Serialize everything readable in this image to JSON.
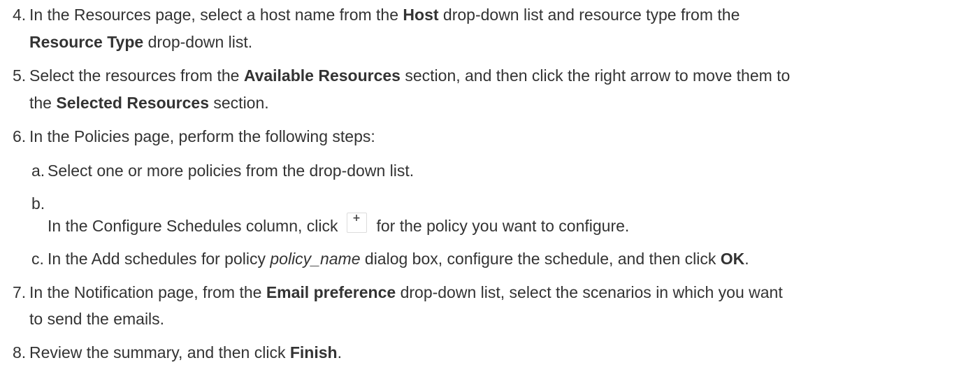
{
  "steps": [
    {
      "num": "4.",
      "line1": {
        "t1": "In the Resources page, select a host name from the ",
        "b1": "Host",
        "t2": " drop-down list and resource type from the"
      },
      "line2": {
        "b1": "Resource Type",
        "t1": " drop-down list."
      }
    },
    {
      "num": "5.",
      "line1": {
        "t1": "Select the resources from the ",
        "b1": "Available Resources",
        "t2": " section, and then click the right arrow to move them to"
      },
      "line2": {
        "t1": "the ",
        "b1": "Selected Resources",
        "t2": " section."
      }
    },
    {
      "num": "6.",
      "text": "In the Policies page, perform the following steps:"
    },
    {
      "num": "a.",
      "text": "Select one or more policies from the drop-down list."
    },
    {
      "num": "b.",
      "t1": "In the Configure Schedules column, click",
      "icon": "plus-icon",
      "icon_glyph": "+",
      "t2": "for the policy you want to configure."
    },
    {
      "num": "c.",
      "t1": "In the Add schedules for policy ",
      "i1": "policy_name",
      "t2": " dialog box, configure the schedule, and then click ",
      "b1": "OK",
      "t3": "."
    },
    {
      "num": "7.",
      "line1": {
        "t1": "In the Notification page, from the ",
        "b1": "Email preference",
        "t2": " drop-down list, select the scenarios in which you want"
      },
      "line2": {
        "t1": "to send the emails."
      }
    },
    {
      "num": "8.",
      "t1": "Review the summary, and then click ",
      "b1": "Finish",
      "t2": "."
    }
  ]
}
